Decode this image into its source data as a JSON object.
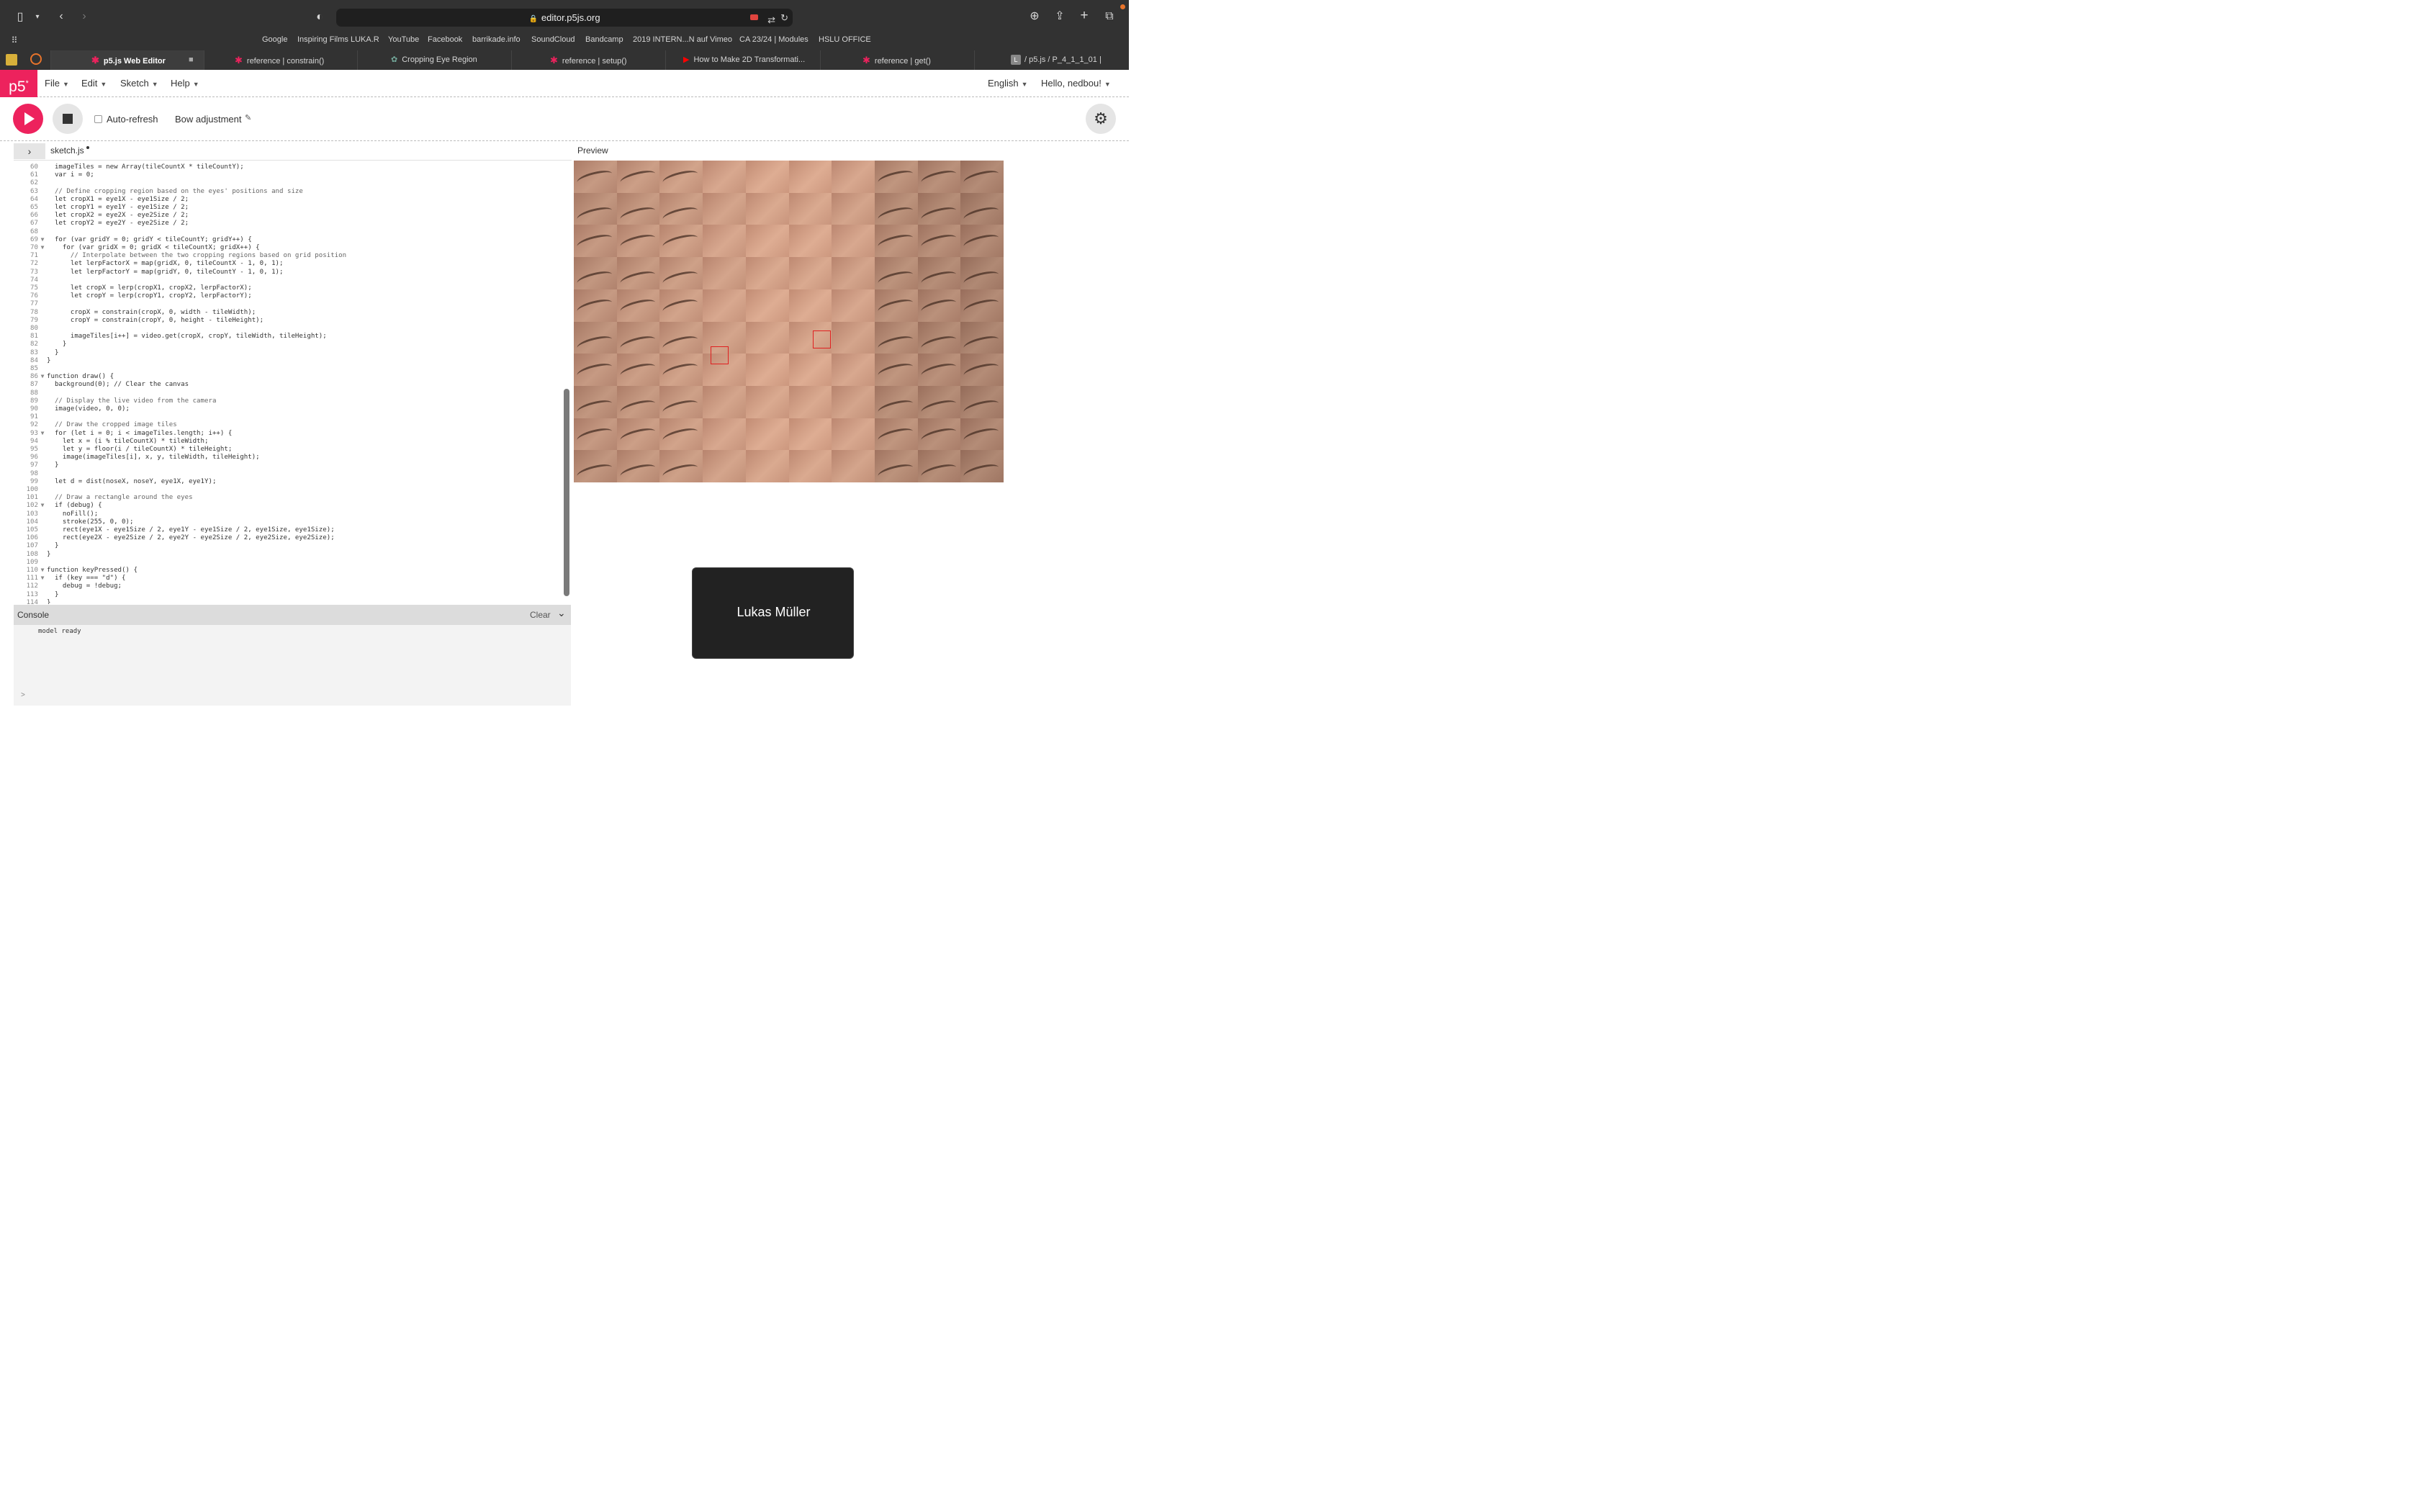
{
  "browser": {
    "url": "editor.p5js.org",
    "bookmarks": [
      "Google",
      "Inspiring Films LUKA.R",
      "YouTube",
      "Facebook",
      "barrikade.info",
      "SoundCloud",
      "Bandcamp",
      "2019 INTERN...N auf Vimeo",
      "CA 23/24 | Modules",
      "HSLU OFFICE"
    ],
    "tabs": [
      "p5.js Web Editor",
      "reference | constrain()",
      "Cropping Eye Region",
      "reference | setup()",
      "How to Make 2D Transformati...",
      "reference | get()",
      "/ p5.js / P_4_1_1_01 |"
    ]
  },
  "nav": {
    "logo": "p5",
    "menus": [
      "File",
      "Edit",
      "Sketch",
      "Help"
    ],
    "language": "English",
    "user": "Hello, nedbou!"
  },
  "toolbar": {
    "autorefresh": "Auto-refresh",
    "sketch_name": "Bow adjustment"
  },
  "editor": {
    "file": "sketch.js",
    "lines": [
      {
        "n": "60",
        "text": "  imageTiles = new Array(tileCountX * tileCountY);"
      },
      {
        "n": "61",
        "text": "  var i = 0;"
      },
      {
        "n": "62",
        "text": ""
      },
      {
        "n": "63",
        "text": "  // Define cropping region based on the eyes' positions and size"
      },
      {
        "n": "64",
        "text": "  let cropX1 = eye1X - eye1Size / 2;"
      },
      {
        "n": "65",
        "text": "  let cropY1 = eye1Y - eye1Size / 2;"
      },
      {
        "n": "66",
        "text": "  let cropX2 = eye2X - eye2Size / 2;"
      },
      {
        "n": "67",
        "text": "  let cropY2 = eye2Y - eye2Size / 2;"
      },
      {
        "n": "68",
        "text": ""
      },
      {
        "n": "69",
        "text": "  for (var gridY = 0; gridY < tileCountY; gridY++) {",
        "fold": true
      },
      {
        "n": "70",
        "text": "    for (var gridX = 0; gridX < tileCountX; gridX++) {",
        "fold": true
      },
      {
        "n": "71",
        "text": "      // Interpolate between the two cropping regions based on grid position"
      },
      {
        "n": "72",
        "text": "      let lerpFactorX = map(gridX, 0, tileCountX - 1, 0, 1);"
      },
      {
        "n": "73",
        "text": "      let lerpFactorY = map(gridY, 0, tileCountY - 1, 0, 1);"
      },
      {
        "n": "74",
        "text": ""
      },
      {
        "n": "75",
        "text": "      let cropX = lerp(cropX1, cropX2, lerpFactorX);"
      },
      {
        "n": "76",
        "text": "      let cropY = lerp(cropY1, cropY2, lerpFactorY);"
      },
      {
        "n": "77",
        "text": ""
      },
      {
        "n": "78",
        "text": "      cropX = constrain(cropX, 0, width - tileWidth);"
      },
      {
        "n": "79",
        "text": "      cropY = constrain(cropY, 0, height - tileHeight);"
      },
      {
        "n": "80",
        "text": ""
      },
      {
        "n": "81",
        "text": "      imageTiles[i++] = video.get(cropX, cropY, tileWidth, tileHeight);"
      },
      {
        "n": "82",
        "text": "    }"
      },
      {
        "n": "83",
        "text": "  }"
      },
      {
        "n": "84",
        "text": "}"
      },
      {
        "n": "85",
        "text": ""
      },
      {
        "n": "86",
        "text": "function draw() {",
        "fold": true
      },
      {
        "n": "87",
        "text": "  background(0); // Clear the canvas"
      },
      {
        "n": "88",
        "text": ""
      },
      {
        "n": "89",
        "text": "  // Display the live video from the camera"
      },
      {
        "n": "90",
        "text": "  image(video, 0, 0);"
      },
      {
        "n": "91",
        "text": ""
      },
      {
        "n": "92",
        "text": "  // Draw the cropped image tiles"
      },
      {
        "n": "93",
        "text": "  for (let i = 0; i < imageTiles.length; i++) {",
        "fold": true
      },
      {
        "n": "94",
        "text": "    let x = (i % tileCountX) * tileWidth;"
      },
      {
        "n": "95",
        "text": "    let y = floor(i / tileCountX) * tileHeight;"
      },
      {
        "n": "96",
        "text": "    image(imageTiles[i], x, y, tileWidth, tileHeight);"
      },
      {
        "n": "97",
        "text": "  }"
      },
      {
        "n": "98",
        "text": ""
      },
      {
        "n": "99",
        "text": "  let d = dist(noseX, noseY, eye1X, eye1Y);"
      },
      {
        "n": "100",
        "text": ""
      },
      {
        "n": "101",
        "text": "  // Draw a rectangle around the eyes"
      },
      {
        "n": "102",
        "text": "  if (debug) {",
        "fold": true
      },
      {
        "n": "103",
        "text": "    noFill();"
      },
      {
        "n": "104",
        "text": "    stroke(255, 0, 0);"
      },
      {
        "n": "105",
        "text": "    rect(eye1X - eye1Size / 2, eye1Y - eye1Size / 2, eye1Size, eye1Size);"
      },
      {
        "n": "106",
        "text": "    rect(eye2X - eye2Size / 2, eye2Y - eye2Size / 2, eye2Size, eye2Size);"
      },
      {
        "n": "107",
        "text": "  }"
      },
      {
        "n": "108",
        "text": "}"
      },
      {
        "n": "109",
        "text": ""
      },
      {
        "n": "110",
        "text": "function keyPressed() {",
        "fold": true
      },
      {
        "n": "111",
        "text": "  if (key === \"d\") {",
        "fold": true
      },
      {
        "n": "112",
        "text": "    debug = !debug;"
      },
      {
        "n": "113",
        "text": "  }"
      },
      {
        "n": "114",
        "text": "}"
      }
    ]
  },
  "console": {
    "title": "Console",
    "clear": "Clear",
    "message": "model ready",
    "prompt": ">"
  },
  "preview": {
    "label": "Preview",
    "video_caller": "Lukas Müller"
  },
  "colors": {
    "accent": "#ed225d"
  }
}
